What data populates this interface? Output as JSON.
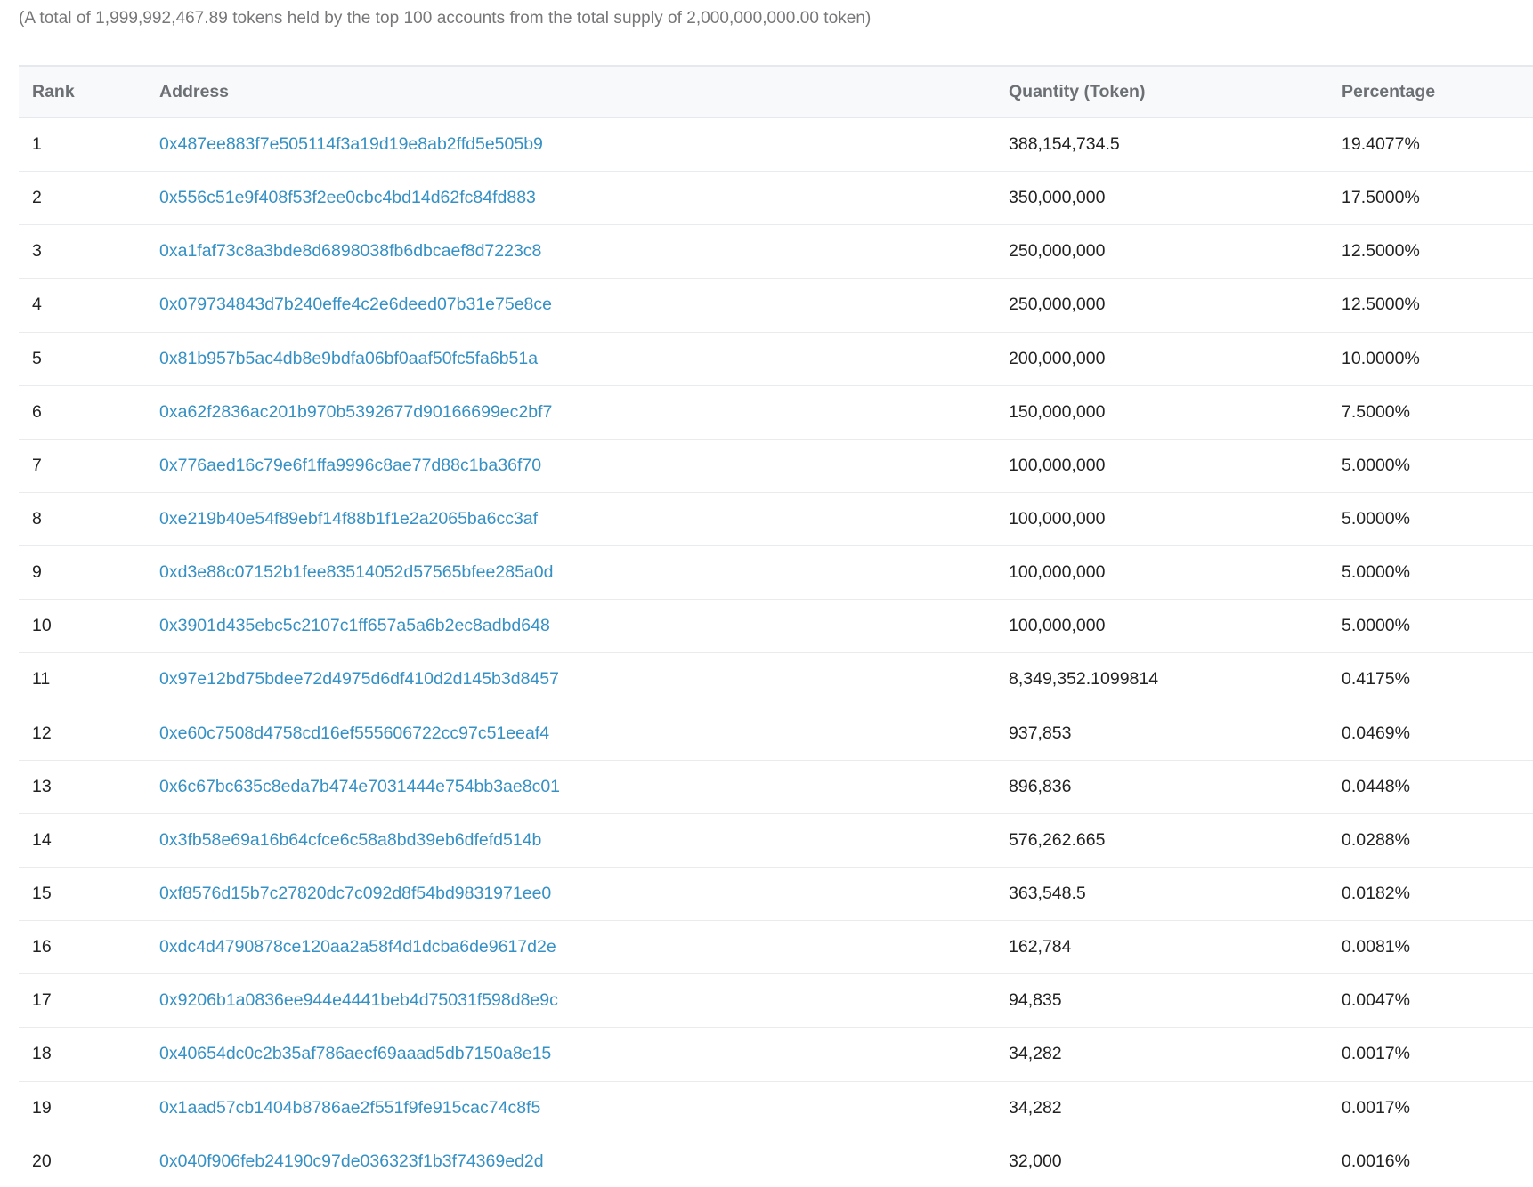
{
  "summary": "(A total of 1,999,992,467.89 tokens held by the top 100 accounts from the total supply of 2,000,000,000.00 token)",
  "table": {
    "headers": {
      "rank": "Rank",
      "address": "Address",
      "quantity": "Quantity (Token)",
      "percentage": "Percentage"
    },
    "rows": [
      {
        "rank": "1",
        "address": "0x487ee883f7e505114f3a19d19e8ab2ffd5e505b9",
        "quantity": "388,154,734.5",
        "percentage": "19.4077%"
      },
      {
        "rank": "2",
        "address": "0x556c51e9f408f53f2ee0cbc4bd14d62fc84fd883",
        "quantity": "350,000,000",
        "percentage": "17.5000%"
      },
      {
        "rank": "3",
        "address": "0xa1faf73c8a3bde8d6898038fb6dbcaef8d7223c8",
        "quantity": "250,000,000",
        "percentage": "12.5000%"
      },
      {
        "rank": "4",
        "address": "0x079734843d7b240effe4c2e6deed07b31e75e8ce",
        "quantity": "250,000,000",
        "percentage": "12.5000%"
      },
      {
        "rank": "5",
        "address": "0x81b957b5ac4db8e9bdfa06bf0aaf50fc5fa6b51a",
        "quantity": "200,000,000",
        "percentage": "10.0000%"
      },
      {
        "rank": "6",
        "address": "0xa62f2836ac201b970b5392677d90166699ec2bf7",
        "quantity": "150,000,000",
        "percentage": "7.5000%"
      },
      {
        "rank": "7",
        "address": "0x776aed16c79e6f1ffa9996c8ae77d88c1ba36f70",
        "quantity": "100,000,000",
        "percentage": "5.0000%"
      },
      {
        "rank": "8",
        "address": "0xe219b40e54f89ebf14f88b1f1e2a2065ba6cc3af",
        "quantity": "100,000,000",
        "percentage": "5.0000%"
      },
      {
        "rank": "9",
        "address": "0xd3e88c07152b1fee83514052d57565bfee285a0d",
        "quantity": "100,000,000",
        "percentage": "5.0000%"
      },
      {
        "rank": "10",
        "address": "0x3901d435ebc5c2107c1ff657a5a6b2ec8adbd648",
        "quantity": "100,000,000",
        "percentage": "5.0000%"
      },
      {
        "rank": "11",
        "address": "0x97e12bd75bdee72d4975d6df410d2d145b3d8457",
        "quantity": "8,349,352.1099814",
        "percentage": "0.4175%"
      },
      {
        "rank": "12",
        "address": "0xe60c7508d4758cd16ef555606722cc97c51eeaf4",
        "quantity": "937,853",
        "percentage": "0.0469%"
      },
      {
        "rank": "13",
        "address": "0x6c67bc635c8eda7b474e7031444e754bb3ae8c01",
        "quantity": "896,836",
        "percentage": "0.0448%"
      },
      {
        "rank": "14",
        "address": "0x3fb58e69a16b64cfce6c58a8bd39eb6dfefd514b",
        "quantity": "576,262.665",
        "percentage": "0.0288%"
      },
      {
        "rank": "15",
        "address": "0xf8576d15b7c27820dc7c092d8f54bd9831971ee0",
        "quantity": "363,548.5",
        "percentage": "0.0182%"
      },
      {
        "rank": "16",
        "address": "0xdc4d4790878ce120aa2a58f4d1dcba6de9617d2e",
        "quantity": "162,784",
        "percentage": "0.0081%"
      },
      {
        "rank": "17",
        "address": "0x9206b1a0836ee944e4441beb4d75031f598d8e9c",
        "quantity": "94,835",
        "percentage": "0.0047%"
      },
      {
        "rank": "18",
        "address": "0x40654dc0c2b35af786aecf69aaad5db7150a8e15",
        "quantity": "34,282",
        "percentage": "0.0017%"
      },
      {
        "rank": "19",
        "address": "0x1aad57cb1404b8786ae2f551f9fe915cac74c8f5",
        "quantity": "34,282",
        "percentage": "0.0017%"
      },
      {
        "rank": "20",
        "address": "0x040f906feb24190c97de036323f1b3f74369ed2d",
        "quantity": "32,000",
        "percentage": "0.0016%"
      }
    ]
  },
  "colors": {
    "link": "#3590c4",
    "header_bg": "#f8f9fa",
    "row_divider": "#e9ecef"
  }
}
